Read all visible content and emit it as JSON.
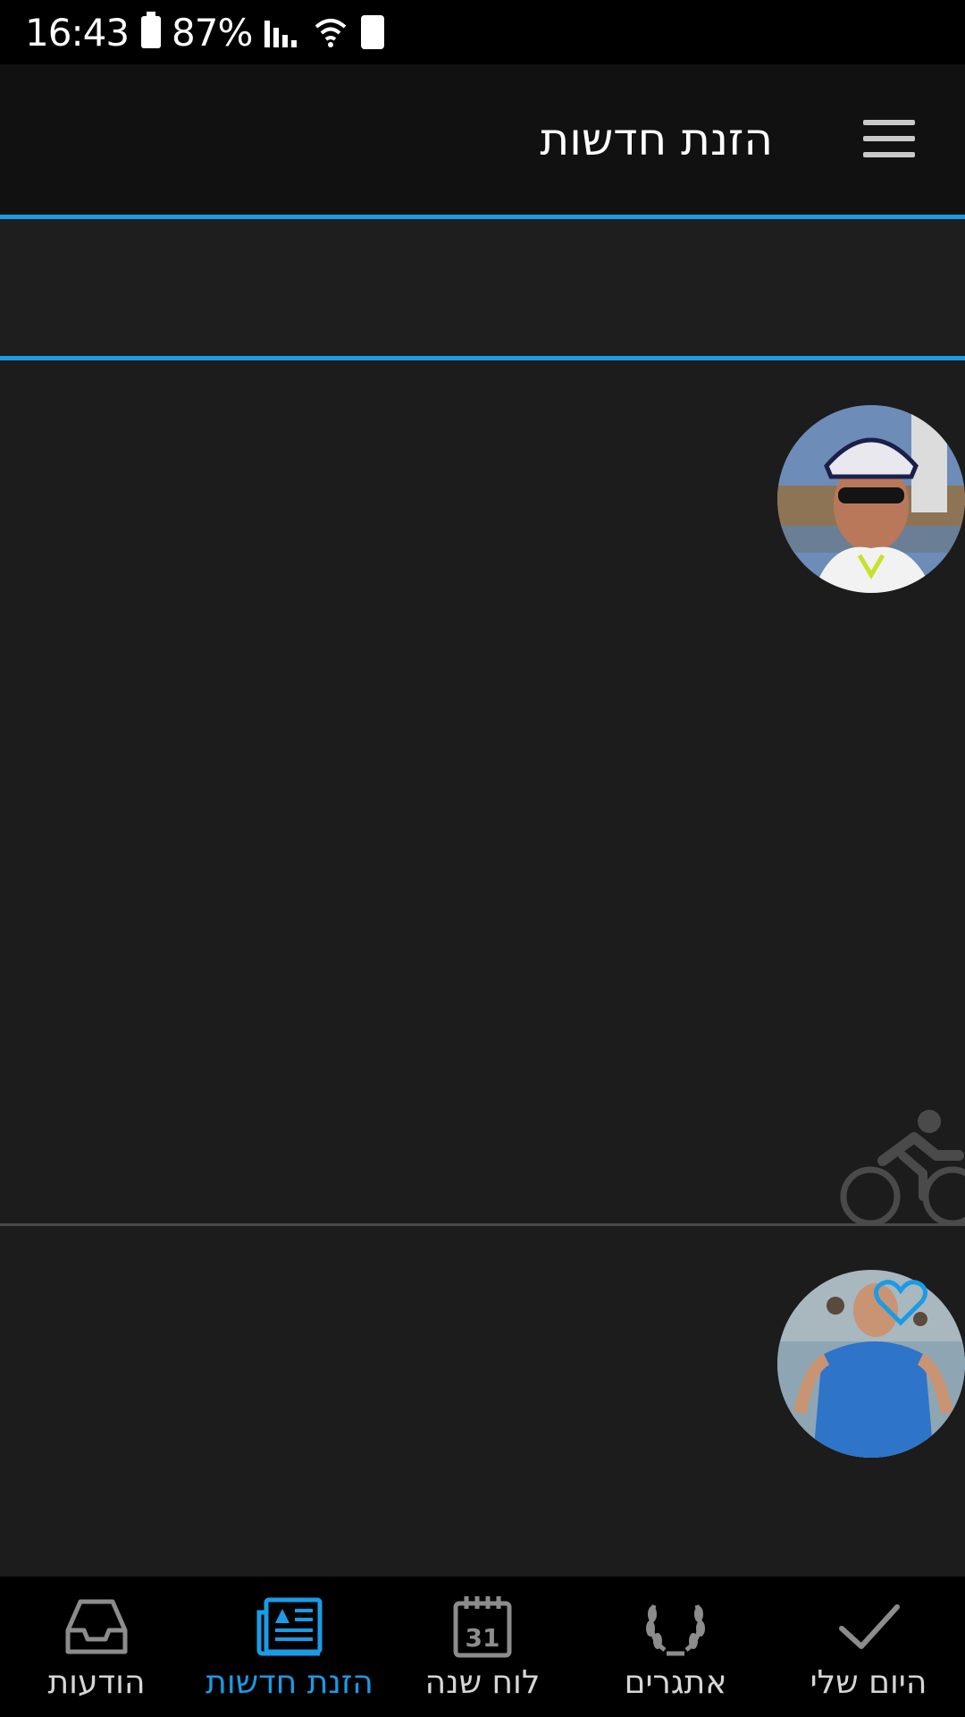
{
  "status_bar": {
    "time": "16:43",
    "battery_percent": "87%"
  },
  "app_bar": {
    "title": "הזנת חדשות",
    "menu_icon": "hamburger-menu-icon"
  },
  "feed": {
    "items": [
      {
        "activity_icon": "cycling-icon",
        "avatar": "cyclist-helmet-avatar"
      },
      {
        "avatar": "man-blue-shirt-avatar",
        "badge_icon": "heart-icon"
      }
    ]
  },
  "bottom_nav": {
    "active": "news-feed",
    "items": [
      {
        "label": "היום שלי",
        "icon": "checkmark-icon"
      },
      {
        "label": "אתגרים",
        "icon": "laurel-wreath-icon"
      },
      {
        "label": "לוח שנה",
        "icon": "calendar-icon",
        "calendar_day": "31"
      },
      {
        "label": "הזנת חדשות",
        "icon": "newspaper-icon"
      },
      {
        "label": "הודעות",
        "icon": "inbox-tray-icon"
      }
    ]
  },
  "colors": {
    "accent": "#1a9be6",
    "background": "#1c1c1c",
    "bar": "#111111"
  }
}
